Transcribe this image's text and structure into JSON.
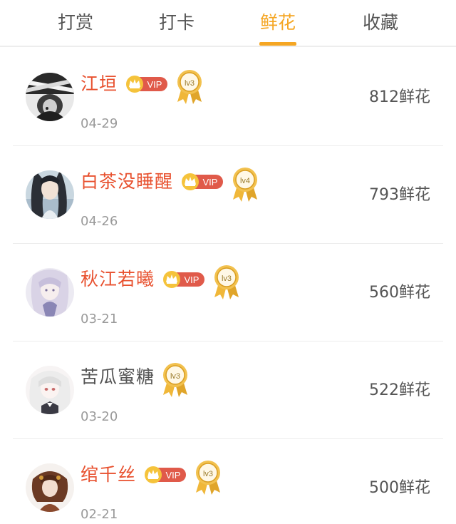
{
  "tabs": [
    {
      "label": "打赏",
      "active": false
    },
    {
      "label": "打卡",
      "active": false
    },
    {
      "label": "鲜花",
      "active": true
    },
    {
      "label": "收藏",
      "active": false
    }
  ],
  "colors": {
    "accent": "#f5a623",
    "vip_name": "#e8512f",
    "normal_name": "#555555",
    "date": "#9a9a9a",
    "vip_badge": "#e05a4a",
    "medal_gold": "#f0b739"
  },
  "vip_badge_text": "VIP",
  "items": [
    {
      "name": "江垣",
      "vip": true,
      "level": "lv3",
      "date": "04-29",
      "flowers": "812鲜花",
      "avatar": "avatar-black-white-icon"
    },
    {
      "name": "白茶没睡醒",
      "vip": true,
      "level": "lv4",
      "date": "04-26",
      "flowers": "793鲜花",
      "avatar": "avatar-dark-hair-icon"
    },
    {
      "name": "秋江若曦",
      "vip": true,
      "level": "lv3",
      "date": "03-21",
      "flowers": "560鲜花",
      "avatar": "avatar-lavender-icon"
    },
    {
      "name": "苦瓜蜜糖",
      "vip": false,
      "level": "lv3",
      "date": "03-20",
      "flowers": "522鲜花",
      "avatar": "avatar-white-hair-icon"
    },
    {
      "name": "绾千丝",
      "vip": true,
      "level": "lv3",
      "date": "02-21",
      "flowers": "500鲜花",
      "avatar": "avatar-brown-hair-icon"
    }
  ]
}
